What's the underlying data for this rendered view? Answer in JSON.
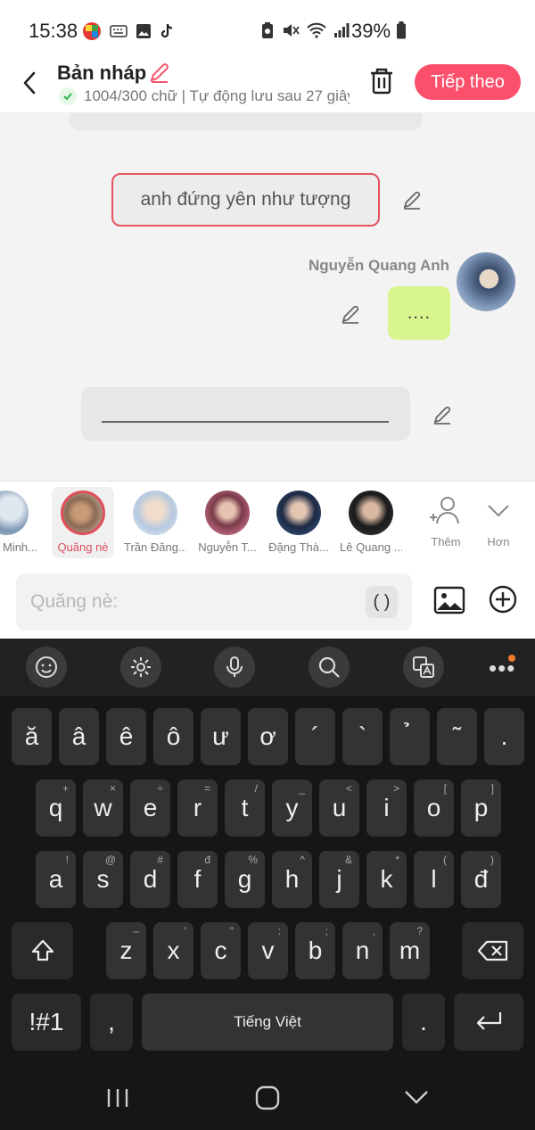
{
  "status": {
    "time": "15:38",
    "battery": "39%"
  },
  "header": {
    "title": "Bản nháp",
    "subtitle": "1004/300 chữ | Tự động lưu sau 27 giây",
    "next_label": "Tiếp theo"
  },
  "chat": {
    "message1": "anh đứng yên như tượng",
    "sender_name": "Nguyễn Quang Anh",
    "message2": "...."
  },
  "characters": [
    {
      "name": "Minh..."
    },
    {
      "name": "Quăng nè"
    },
    {
      "name": "Trần Đăng..."
    },
    {
      "name": "Nguyễn T..."
    },
    {
      "name": "Đặng Thà..."
    },
    {
      "name": "Lê Quang ..."
    }
  ],
  "controls": {
    "add_label": "Thêm",
    "more_label": "Hơn"
  },
  "input": {
    "placeholder": "Quăng nè:",
    "paren_label": "( )"
  },
  "keyboard": {
    "row0": [
      "ă",
      "â",
      "ê",
      "ô",
      "ư",
      "ơ",
      "´",
      "`",
      "̉",
      "˜",
      "."
    ],
    "row1": [
      {
        "k": "q",
        "h": "+"
      },
      {
        "k": "w",
        "h": "×"
      },
      {
        "k": "e",
        "h": "÷"
      },
      {
        "k": "r",
        "h": "="
      },
      {
        "k": "t",
        "h": "/"
      },
      {
        "k": "y",
        "h": "_"
      },
      {
        "k": "u",
        "h": "<"
      },
      {
        "k": "i",
        "h": ">"
      },
      {
        "k": "o",
        "h": "["
      },
      {
        "k": "p",
        "h": "]"
      }
    ],
    "row2": [
      {
        "k": "a",
        "h": "!"
      },
      {
        "k": "s",
        "h": "@"
      },
      {
        "k": "d",
        "h": "#"
      },
      {
        "k": "f",
        "h": "đ"
      },
      {
        "k": "g",
        "h": "%"
      },
      {
        "k": "h",
        "h": "^"
      },
      {
        "k": "j",
        "h": "&"
      },
      {
        "k": "k",
        "h": "*"
      },
      {
        "k": "l",
        "h": "("
      },
      {
        "k": "đ",
        "h": ")"
      }
    ],
    "row3": [
      {
        "k": "z",
        "h": "–"
      },
      {
        "k": "x",
        "h": "'"
      },
      {
        "k": "c",
        "h": "\""
      },
      {
        "k": "v",
        "h": ":"
      },
      {
        "k": "b",
        "h": ";"
      },
      {
        "k": "n",
        "h": ","
      },
      {
        "k": "m",
        "h": "?"
      }
    ],
    "symbols_label": "!#1",
    "comma": ",",
    "space_label": "Tiếng Việt",
    "period": "."
  },
  "colors": {
    "accent": "#fb4f6b",
    "selected_border": "#e04f5c",
    "green_bubble": "#d9f58e"
  }
}
